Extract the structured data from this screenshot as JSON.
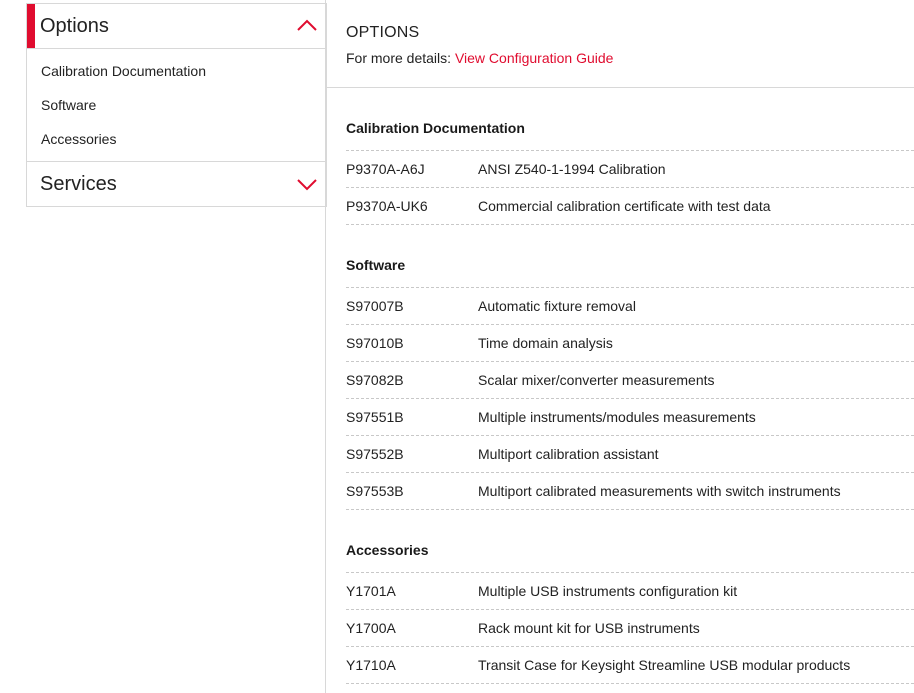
{
  "sidebar": {
    "options": {
      "title": "Options",
      "links": [
        {
          "label": "Calibration Documentation"
        },
        {
          "label": "Software"
        },
        {
          "label": "Accessories"
        }
      ]
    },
    "services": {
      "title": "Services"
    }
  },
  "main": {
    "title": "OPTIONS",
    "details_prefix": "For more details:",
    "details_link": "View Configuration Guide",
    "sections": [
      {
        "title": "Calibration Documentation",
        "rows": [
          {
            "code": "P9370A-A6J",
            "desc": "ANSI Z540-1-1994 Calibration"
          },
          {
            "code": "P9370A-UK6",
            "desc": "Commercial calibration certificate with test data"
          }
        ]
      },
      {
        "title": "Software",
        "rows": [
          {
            "code": "S97007B",
            "desc": "Automatic fixture removal"
          },
          {
            "code": "S97010B",
            "desc": "Time domain analysis"
          },
          {
            "code": "S97082B",
            "desc": "Scalar mixer/converter measurements"
          },
          {
            "code": "S97551B",
            "desc": "Multiple instruments/modules measurements"
          },
          {
            "code": "S97552B",
            "desc": "Multiport calibration assistant"
          },
          {
            "code": "S97553B",
            "desc": "Multiport calibrated measurements with switch instruments"
          }
        ]
      },
      {
        "title": "Accessories",
        "rows": [
          {
            "code": "Y1701A",
            "desc": "Multiple USB instruments configuration kit"
          },
          {
            "code": "Y1700A",
            "desc": "Rack mount kit for USB instruments"
          },
          {
            "code": "Y1710A",
            "desc": "Transit Case for Keysight Streamline USB modular products"
          }
        ]
      }
    ]
  },
  "colors": {
    "accent": "#e00c2f",
    "border": "#d8d8d8",
    "text": "#222222"
  },
  "icons": {
    "options_toggle": "chevron-up-icon",
    "services_toggle": "chevron-down-icon"
  }
}
